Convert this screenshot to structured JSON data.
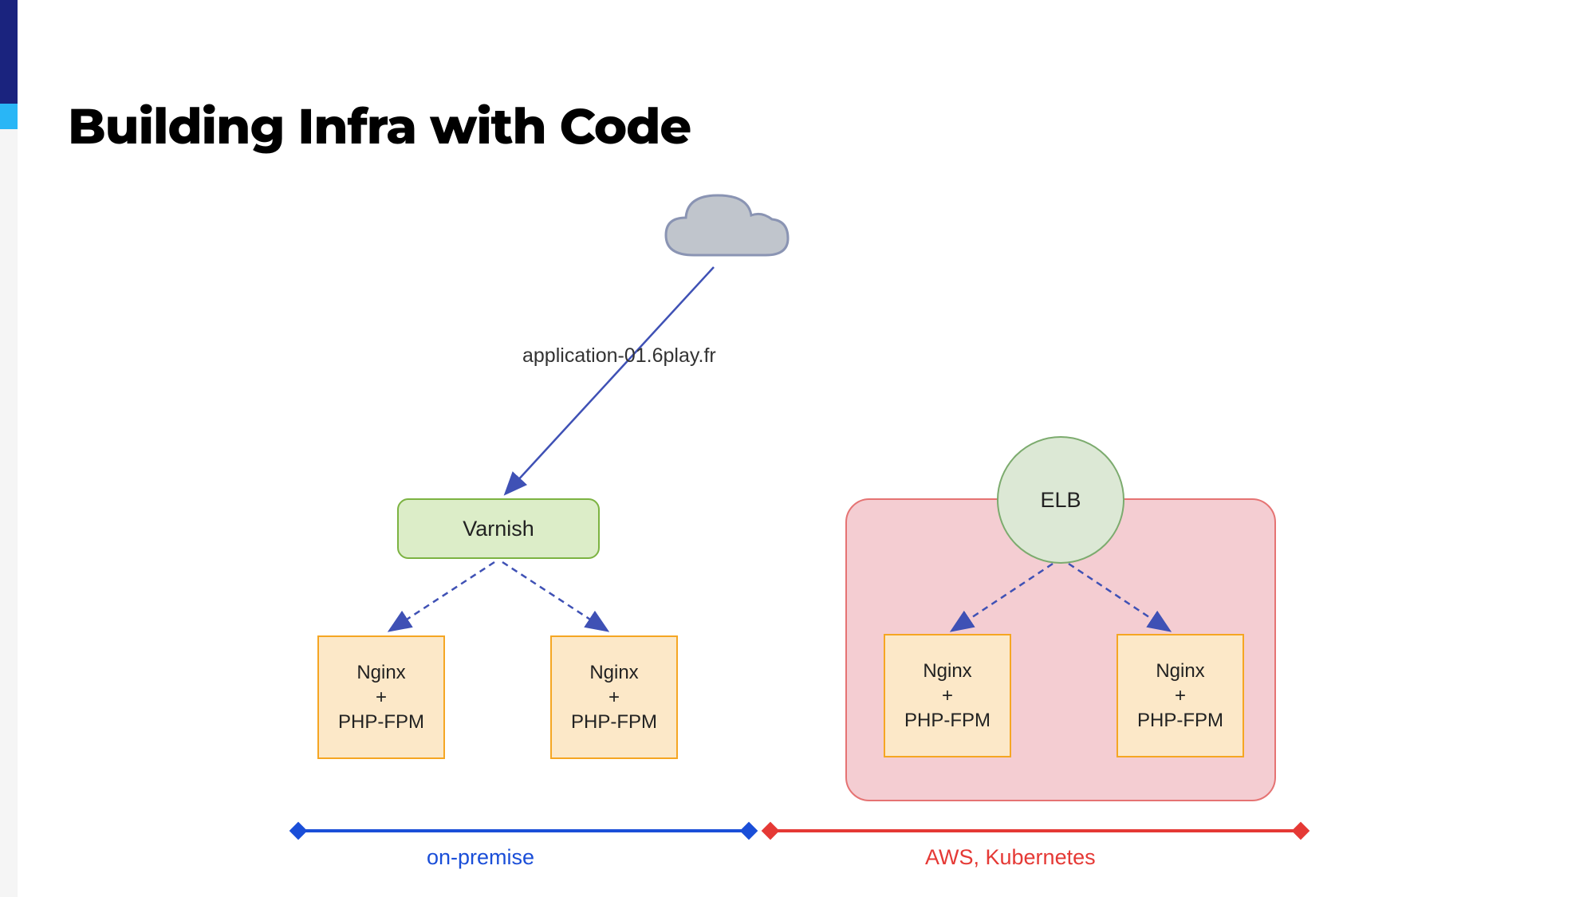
{
  "title": "Building Infra with Code",
  "link_label": "application-01.6play.fr",
  "varnish_label": "Varnish",
  "elb_label": "ELB",
  "nginx_box": {
    "line1": "Nginx",
    "line2": "+",
    "line3": "PHP-FPM"
  },
  "braces": {
    "left": "on-premise",
    "right": "AWS, Kubernetes"
  },
  "colors": {
    "accent_dark": "#1a237e",
    "accent_light": "#29b6f6",
    "blue": "#1a4ed8",
    "red": "#e53935",
    "green_fill": "#dcedc8",
    "green_border": "#7cb342",
    "orange_fill": "#fce8c8",
    "orange_border": "#f5a623",
    "pink_fill": "#f4cdd2",
    "pink_border": "#e57373",
    "cloud_fill": "#c0c5cc",
    "cloud_border": "#8a94b3"
  }
}
